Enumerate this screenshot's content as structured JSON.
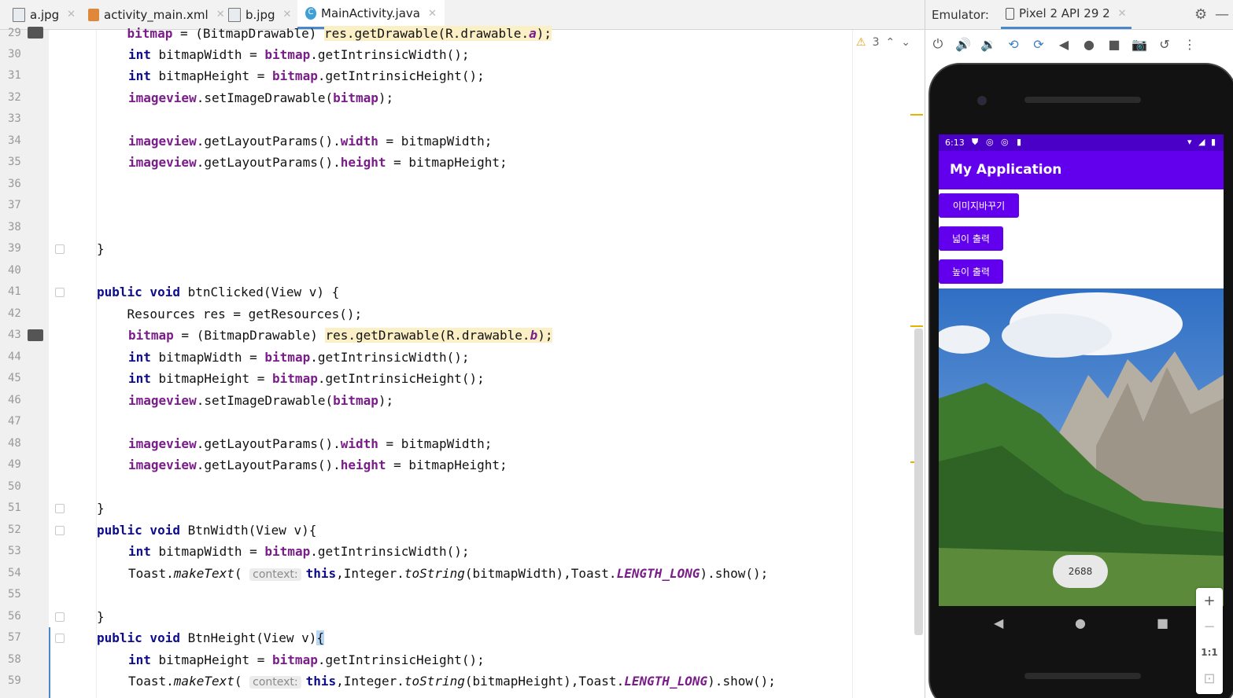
{
  "tabs": [
    {
      "label": "a.jpg",
      "icon": "image-file-icon"
    },
    {
      "label": "activity_main.xml",
      "icon": "xml-file-icon"
    },
    {
      "label": "b.jpg",
      "icon": "image-file-icon"
    },
    {
      "label": "MainActivity.java",
      "icon": "java-class-icon",
      "active": true
    }
  ],
  "warnings": {
    "count": "3"
  },
  "code_lines": [
    {
      "n": "29"
    },
    {
      "n": "30"
    },
    {
      "n": "31"
    },
    {
      "n": "32"
    },
    {
      "n": "33"
    },
    {
      "n": "34"
    },
    {
      "n": "35"
    },
    {
      "n": "36"
    },
    {
      "n": "37"
    },
    {
      "n": "38"
    },
    {
      "n": "39"
    },
    {
      "n": "40"
    },
    {
      "n": "41"
    },
    {
      "n": "42"
    },
    {
      "n": "43"
    },
    {
      "n": "44"
    },
    {
      "n": "45"
    },
    {
      "n": "46"
    },
    {
      "n": "47"
    },
    {
      "n": "48"
    },
    {
      "n": "49"
    },
    {
      "n": "50"
    },
    {
      "n": "51"
    },
    {
      "n": "52"
    },
    {
      "n": "53"
    },
    {
      "n": "54"
    },
    {
      "n": "55"
    },
    {
      "n": "56"
    },
    {
      "n": "57"
    },
    {
      "n": "58"
    },
    {
      "n": "59"
    }
  ],
  "code": {
    "l29": {
      "a": "    bitmap",
      "b": " = (BitmapDrawable) ",
      "c": "res.getDrawable(R.drawable.",
      "d": "a",
      "e": ");"
    },
    "bitmapWidthDecl": {
      "kw": "int",
      "rest": " bitmapWidth = ",
      "fld": "bitmap",
      "call": ".getIntrinsicWidth();"
    },
    "bitmapHeightDecl": {
      "kw": "int",
      "rest": " bitmapHeight = ",
      "fld": "bitmap",
      "call": ".getIntrinsicHeight();"
    },
    "setImage": {
      "fld": "imageview",
      "call": ".setImageDrawable(",
      "fld2": "bitmap",
      "end": ");"
    },
    "lpWidth": {
      "fld": "imageview",
      "call": ".getLayoutParams().",
      "prop": "width",
      "end": " = bitmapWidth;"
    },
    "lpHeight": {
      "fld": "imageview",
      "call": ".getLayoutParams().",
      "prop": "height",
      "end": " = bitmapHeight;"
    },
    "closeBrace": "}",
    "btnClicked": {
      "kw": "public void",
      "rest": " btnClicked(View v) {"
    },
    "resources": "    Resources res = getResources();",
    "l43": {
      "fld": "bitmap",
      "mid": " = (BitmapDrawable) ",
      "hl": "res.getDrawable(R.drawable.",
      "it": "b",
      "end": ");"
    },
    "btnWidth": {
      "kw": "public void",
      "rest": " BtnWidth(View v){"
    },
    "btnHeight": {
      "kw": "public void",
      "rest": " BtnHeight(View v)",
      "brace": "{"
    },
    "toastW": {
      "a": "Toast.",
      "b": "makeText",
      "c": "( ",
      "hint": "context:",
      "kw": "this",
      "d": ",Integer.",
      "e": "toString",
      "f": "(bitmapWidth),Toast.",
      "g": "LENGTH_LONG",
      "h": ").show();"
    },
    "toastH": {
      "a": "Toast.",
      "b": "makeText",
      "c": "( ",
      "hint": "context:",
      "kw": "this",
      "d": ",Integer.",
      "e": "toString",
      "f": "(bitmapHeight),Toast.",
      "g": "LENGTH_LONG",
      "h": ").show();"
    }
  },
  "emulator": {
    "label": "Emulator:",
    "device": "Pixel 2 API 29 2",
    "status_time": "6:13",
    "app_title": "My Application",
    "buttons": [
      "이미지바꾸기",
      "넓이 출력",
      "높이 출력"
    ],
    "toast": "2688",
    "zoom": [
      "+",
      "−",
      "1:1",
      "⊡"
    ]
  }
}
